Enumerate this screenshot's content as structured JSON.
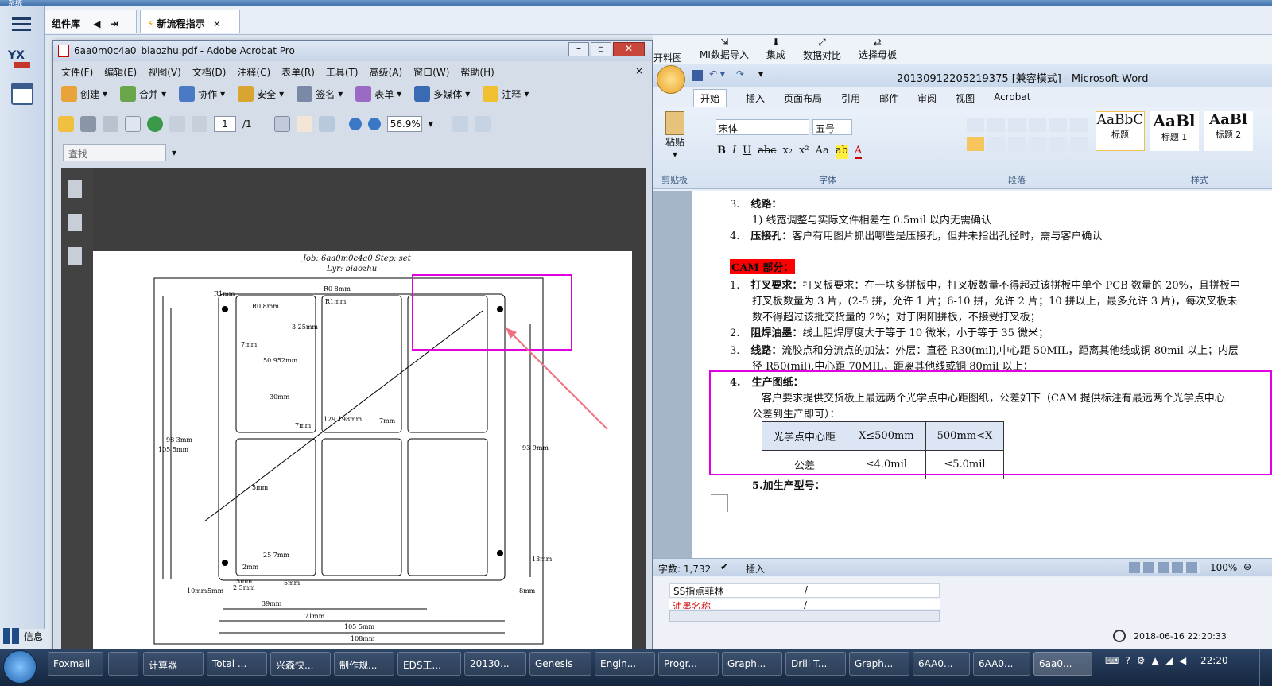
{
  "top_strip": {
    "label": "系统"
  },
  "host": {
    "tabs": [
      {
        "label": "组件库"
      },
      {
        "label": "新流程指示"
      }
    ],
    "left_icons": [
      "menu-icon",
      "yx-icon",
      "calendar-icon"
    ],
    "left_bottom_label": "信息"
  },
  "acrobat": {
    "title": "6aa0m0c4a0_biaozhu.pdf - Adobe Acrobat Pro",
    "menu": [
      "文件(F)",
      "编辑(E)",
      "视图(V)",
      "文档(D)",
      "注释(C)",
      "表单(R)",
      "工具(T)",
      "高级(A)",
      "窗口(W)",
      "帮助(H)"
    ],
    "toolbar1": [
      "创建",
      "合并",
      "协作",
      "安全",
      "签名",
      "表单",
      "多媒体",
      "注释"
    ],
    "page_current": "1",
    "page_total": "/1",
    "zoom": "56.9%",
    "search_placeholder": "查找",
    "drawing": {
      "job_line": "Job: 6aa0m0c4a0 Step: set",
      "lyr_line": "Lyr: biaozhu",
      "dims": [
        "R1mm",
        "R0 8mm",
        "R0 8mm",
        "R1mm",
        "3 25mm",
        "7mm",
        "50 952mm",
        "30mm",
        "7mm",
        "7mm",
        "129 198mm",
        "93 9mm",
        "98 3mm",
        "105 5mm",
        "5mm",
        "25 7mm",
        "2mm",
        "5mm",
        "2 5mm",
        "5mm",
        "39mm",
        "71mm",
        "105 5mm",
        "108mm",
        "10mm",
        "8mm",
        "13mm",
        "5mm"
      ]
    }
  },
  "word": {
    "ribbon_top_buttons": [
      "开料图",
      "MI数据导入",
      "集成",
      "数据对比",
      "选择母板"
    ],
    "title": "20130912205219375 [兼容模式] - Microsoft Word",
    "tabs": [
      "开始",
      "插入",
      "页面布局",
      "引用",
      "邮件",
      "审阅",
      "视图",
      "Acrobat"
    ],
    "font_name": "宋体",
    "font_size": "五号",
    "group_labels": [
      "剪贴板",
      "字体",
      "段落",
      "样式"
    ],
    "paste_label": "粘贴",
    "styles": [
      {
        "preview": "AaBbC",
        "name": "标题"
      },
      {
        "preview": "AaBl",
        "name": "标题 1"
      },
      {
        "preview": "AaBl",
        "name": "标题 2"
      }
    ],
    "doc": {
      "l1_num": "3.",
      "l1_head": "线路：",
      "l2": "1) 线宽调整与实际文件相差在 0.5mil 以内无需确认",
      "l3_num": "4.",
      "l3_head": "压接孔：",
      "l3_text": "客户有用图片抓出哪些是压接孔，但并未指出孔径时，需与客户确认",
      "cam_head": "CAM 部分：",
      "p1_num": "1.",
      "p1_head": "打叉要求：",
      "p1_text": "打叉板要求：在一块多拼板中，打叉板数量不得超过该拼板中单个 PCB 数量的 20%，且拼板中",
      "p1_l2": "打叉板数量为 3 片，(2-5 拼，允许 1 片；6-10 拼，允许 2 片；10 拼以上，最多允许 3 片)，每次叉板未",
      "p1_l3": "数不得超过该批交货量的 2%；对于阴阳拼板，不接受打叉板；",
      "p2_num": "2.",
      "p2_head": "阻焊油墨：",
      "p2_text": "线上阻焊厚度大于等于 10 微米，小于等于 35 微米；",
      "p3_num": "3.",
      "p3_head": "线路：",
      "p3_text": "流胶点和分流点的加法：外层：直径 R30(mil),中心距 50MIL，距离其他线或铜 80mil 以上；内层",
      "p3_l2": "径 R50(mil),中心距 70MIL，距离其他线或铜 80mil 以上；",
      "p4_num": "4.",
      "p4_head": "生产图纸：",
      "p4_text": "客户要求提供交货板上最远两个光学点中心距图纸，公差如下（CAM 提供标注有最远两个光学点中心",
      "p4_l2": "公差到生产即可）：",
      "table": [
        [
          "光学点中心距",
          "X≤500mm",
          "500mm<X"
        ],
        [
          "公差",
          "≤4.0mil",
          "≤5.0mil"
        ]
      ],
      "p5": "5.加生产型号："
    },
    "status_words": "字数: 1,732",
    "status_insert": "插入",
    "status_zoom": "100%",
    "grid_rows": [
      [
        "SS指点菲林",
        "/"
      ],
      [
        "油墨名称",
        "/"
      ]
    ],
    "clock_label": "2018-06-16 22:20:33"
  },
  "taskbar": {
    "items": [
      "Foxmail",
      "",
      "计算器",
      "Total ...",
      "兴森快...",
      "制作规...",
      "EDS工...",
      "20130...",
      "Genesis",
      "Engin...",
      "Progr...",
      "Graph...",
      "Drill T...",
      "Graph...",
      "6AA0...",
      "6AA0...",
      "6aa0..."
    ],
    "time": "22:20"
  },
  "colors": {
    "highlight": "#e000e0",
    "arrow": "#f07080",
    "cam_bg": "#ff0000"
  }
}
